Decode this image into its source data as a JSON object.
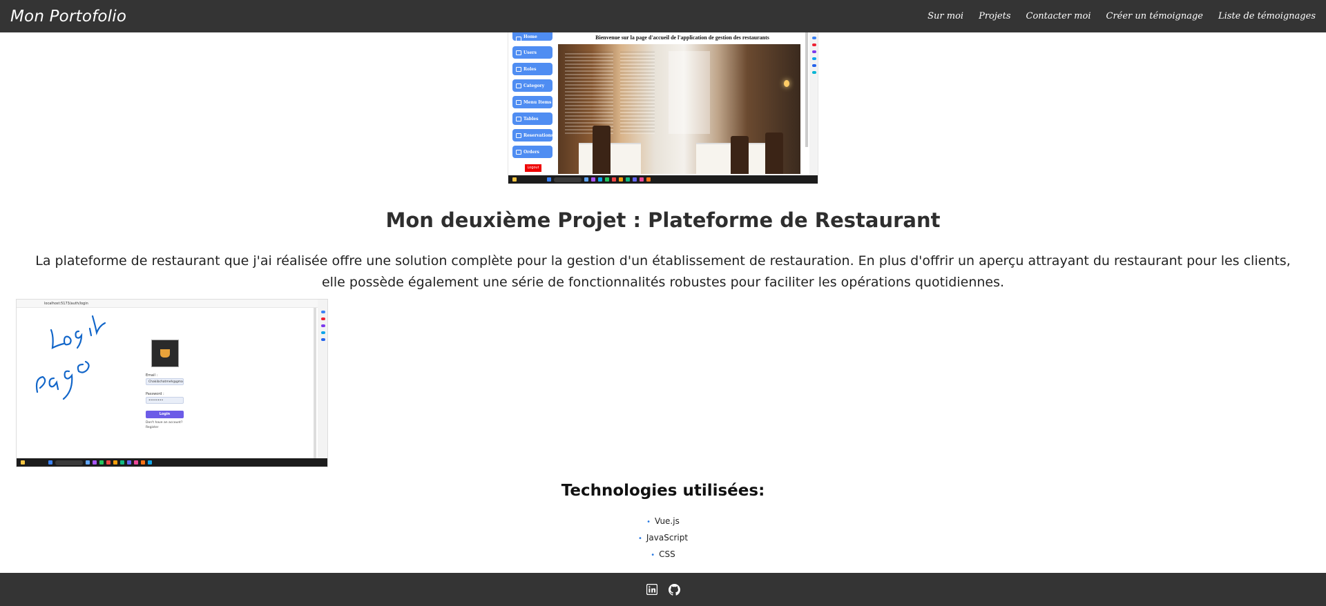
{
  "nav": {
    "brand": "Mon Portofolio",
    "links": [
      "Sur moi",
      "Projets",
      "Contacter moi",
      "Créer un témoignage",
      "Liste de témoignages"
    ]
  },
  "screenshot_restaurant": {
    "sidebar_items": [
      "Home",
      "Users",
      "Roles",
      "Category",
      "Menu Items",
      "Tables",
      "Reservations",
      "Orders"
    ],
    "logout": "Logout",
    "welcome": "Bienvenue sur la page d'accueil de l'application de gestion des restaurants"
  },
  "project": {
    "title": "Mon deuxième Projet : Plateforme de Restaurant",
    "description": "La plateforme de restaurant que j'ai réalisée offre une solution complète pour la gestion d'un établissement de restauration. En plus d'offrir un aperçu attrayant du restaurant pour les clients, elle possède également une série de fonctionnalités robustes pour faciliter les opérations quotidiennes."
  },
  "screenshot_login": {
    "url": "localhost:5173/auth/login",
    "email_label": "Email :",
    "email_value": "Chakibchatmeh@gmail.c",
    "password_label": "Password :",
    "password_value": "••••••••",
    "login_button": "Login",
    "no_account": "Don't have an account?",
    "register": "Register",
    "handwriting": "Login Page"
  },
  "technologies": {
    "title": "Technologies utilisées:",
    "items": [
      "Vue.js",
      "JavaScript",
      "CSS"
    ]
  },
  "footer": {
    "icons": [
      "linkedin-icon",
      "github-icon"
    ]
  }
}
